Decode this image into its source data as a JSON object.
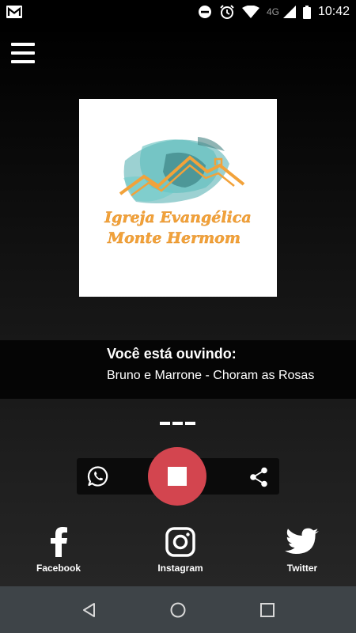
{
  "status_bar": {
    "time": "10:42",
    "network": "4G",
    "icons": [
      "gmail-icon",
      "dnd-icon",
      "alarm-icon",
      "wifi-icon",
      "signal-icon",
      "battery-icon"
    ]
  },
  "menu": {
    "icon": "hamburger-menu-icon"
  },
  "logo": {
    "line1": "Igreja Evangélica",
    "line2": "Monte Hermom",
    "colors": {
      "teal": "#2a9d9f",
      "orange": "#f2a23a"
    }
  },
  "now_playing": {
    "title": "Você está ouvindo:",
    "song": "Bruno e Marrone - Choram as Rosas"
  },
  "player": {
    "loading_indicator": "---",
    "whatsapp_icon": "whatsapp-icon",
    "stop_icon": "stop-icon",
    "share_icon": "share-icon",
    "stop_color": "#d3454f"
  },
  "social": {
    "facebook": "Facebook",
    "instagram": "Instagram",
    "twitter": "Twitter"
  },
  "nav": {
    "back": "back-icon",
    "home": "home-icon",
    "recents": "recents-icon"
  }
}
